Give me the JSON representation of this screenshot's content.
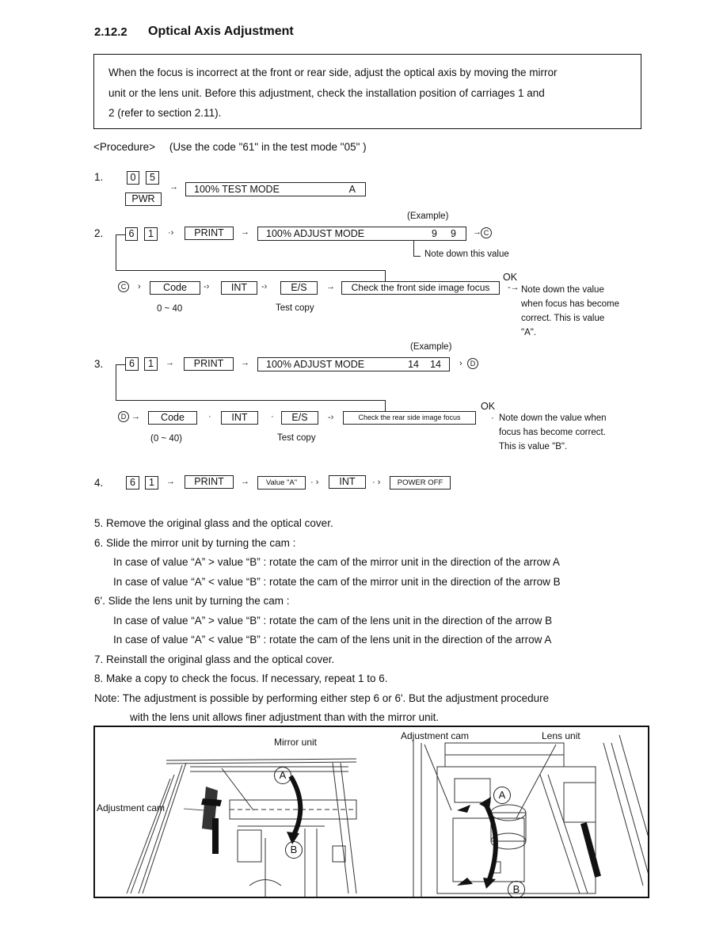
{
  "section": {
    "number": "2.12.2",
    "title": "Optical Axis Adjustment"
  },
  "intro": {
    "text": "When the focus is incorrect at the front or rear side, adjust the optical axis by moving the mirror unit or the lens unit. Before this adjustment, check the installation position of carriages 1 and 2 (refer to section 2.11).",
    "lines": [
      "When the focus is incorrect at the front or rear side, adjust the optical axis by moving the mirror",
      "unit or the lens unit. Before this adjustment, check the installation position of carriages 1 and",
      "2 (refer to section 2.11)."
    ]
  },
  "procedure": {
    "label": "<Procedure>",
    "note": "(Use the code \"61\" in the test mode \"05\" )"
  },
  "step1": {
    "num": "1.",
    "keys": [
      "0",
      "5"
    ],
    "power_key": "PWR",
    "display": "100% TEST MODE",
    "display_value": "A"
  },
  "step2": {
    "num": "2.",
    "keys": [
      "6",
      "1"
    ],
    "print_key": "PRINT",
    "example_label": "(Example)",
    "display": "100% ADJUST MODE",
    "display_values": [
      "9",
      "9"
    ],
    "goto": "C",
    "note": "Note down this value",
    "sub": {
      "marker": "C",
      "code_key": "Code",
      "code_range": "0 ~ 40",
      "int_key": "INT",
      "es_key": "E/S",
      "es_caption": "Test copy",
      "check_box": "Check the front side image focus",
      "ok": "OK",
      "note_lines": [
        "Note down the value",
        "when focus has become",
        "correct.  This is value",
        "\"A\"."
      ]
    }
  },
  "step3": {
    "num": "3.",
    "keys": [
      "6",
      "1"
    ],
    "print_key": "PRINT",
    "example_label": "(Example)",
    "display": "100% ADJUST MODE",
    "display_values": [
      "14",
      "14"
    ],
    "goto": "D",
    "sub": {
      "marker": "D",
      "code_key": "Code",
      "code_range": "(0 ~ 40)",
      "int_key": "INT",
      "es_key": "E/S",
      "es_caption": "Test copy",
      "check_box": "Check the rear side image focus",
      "ok": "OK",
      "note_lines": [
        "Note down the value when",
        "focus has become correct.",
        "This is value \"B\"."
      ]
    }
  },
  "step4": {
    "num": "4.",
    "keys": [
      "6",
      "1"
    ],
    "print_key": "PRINT",
    "value_box": "Value \"A\"",
    "int_key": "INT",
    "power_off": "POWER OFF"
  },
  "instructions": [
    {
      "num": "5.",
      "text": "Remove the original glass and the optical cover.",
      "indent": false
    },
    {
      "num": "6.",
      "text": "Slide the mirror unit by turning the cam :",
      "indent": false
    },
    {
      "num": "",
      "text": "In case of value “A” > value “B” : rotate the cam of the mirror unit in the direction of the arrow A",
      "indent": true
    },
    {
      "num": "",
      "text": "In case of value “A” < value “B” : rotate the cam of the mirror unit in the direction of the arrow B",
      "indent": true
    },
    {
      "num": "6'.",
      "text": "Slide the lens unit by turning the cam :",
      "indent": false
    },
    {
      "num": "",
      "text": "In case of value “A” > value “B” : rotate the cam of the lens unit in the direction of the arrow B",
      "indent": true
    },
    {
      "num": "",
      "text": "In case of value “A” < value “B” : rotate the cam of the lens unit in the direction of the arrow A",
      "indent": true
    },
    {
      "num": "7.",
      "text": "Reinstall the original glass and the optical cover.",
      "indent": false
    },
    {
      "num": "8.",
      "text": "Make a copy to check the focus. If necessary, repeat 1 to 6.",
      "indent": false
    }
  ],
  "note": {
    "label": "Note:",
    "line1": "The adjustment is possible by performing either step 6 or 6'. But the adjustment procedure",
    "line2": "with the lens unit allows finer adjustment than with the mirror unit."
  },
  "figure": {
    "left": {
      "label_mirror": "Mirror unit",
      "label_cam": "Adjustment cam",
      "arrow_a": "A",
      "arrow_b": "B"
    },
    "right": {
      "label_cam": "Adjustment cam",
      "label_lens": "Lens unit",
      "arrow_a": "A",
      "arrow_b": "B"
    }
  }
}
